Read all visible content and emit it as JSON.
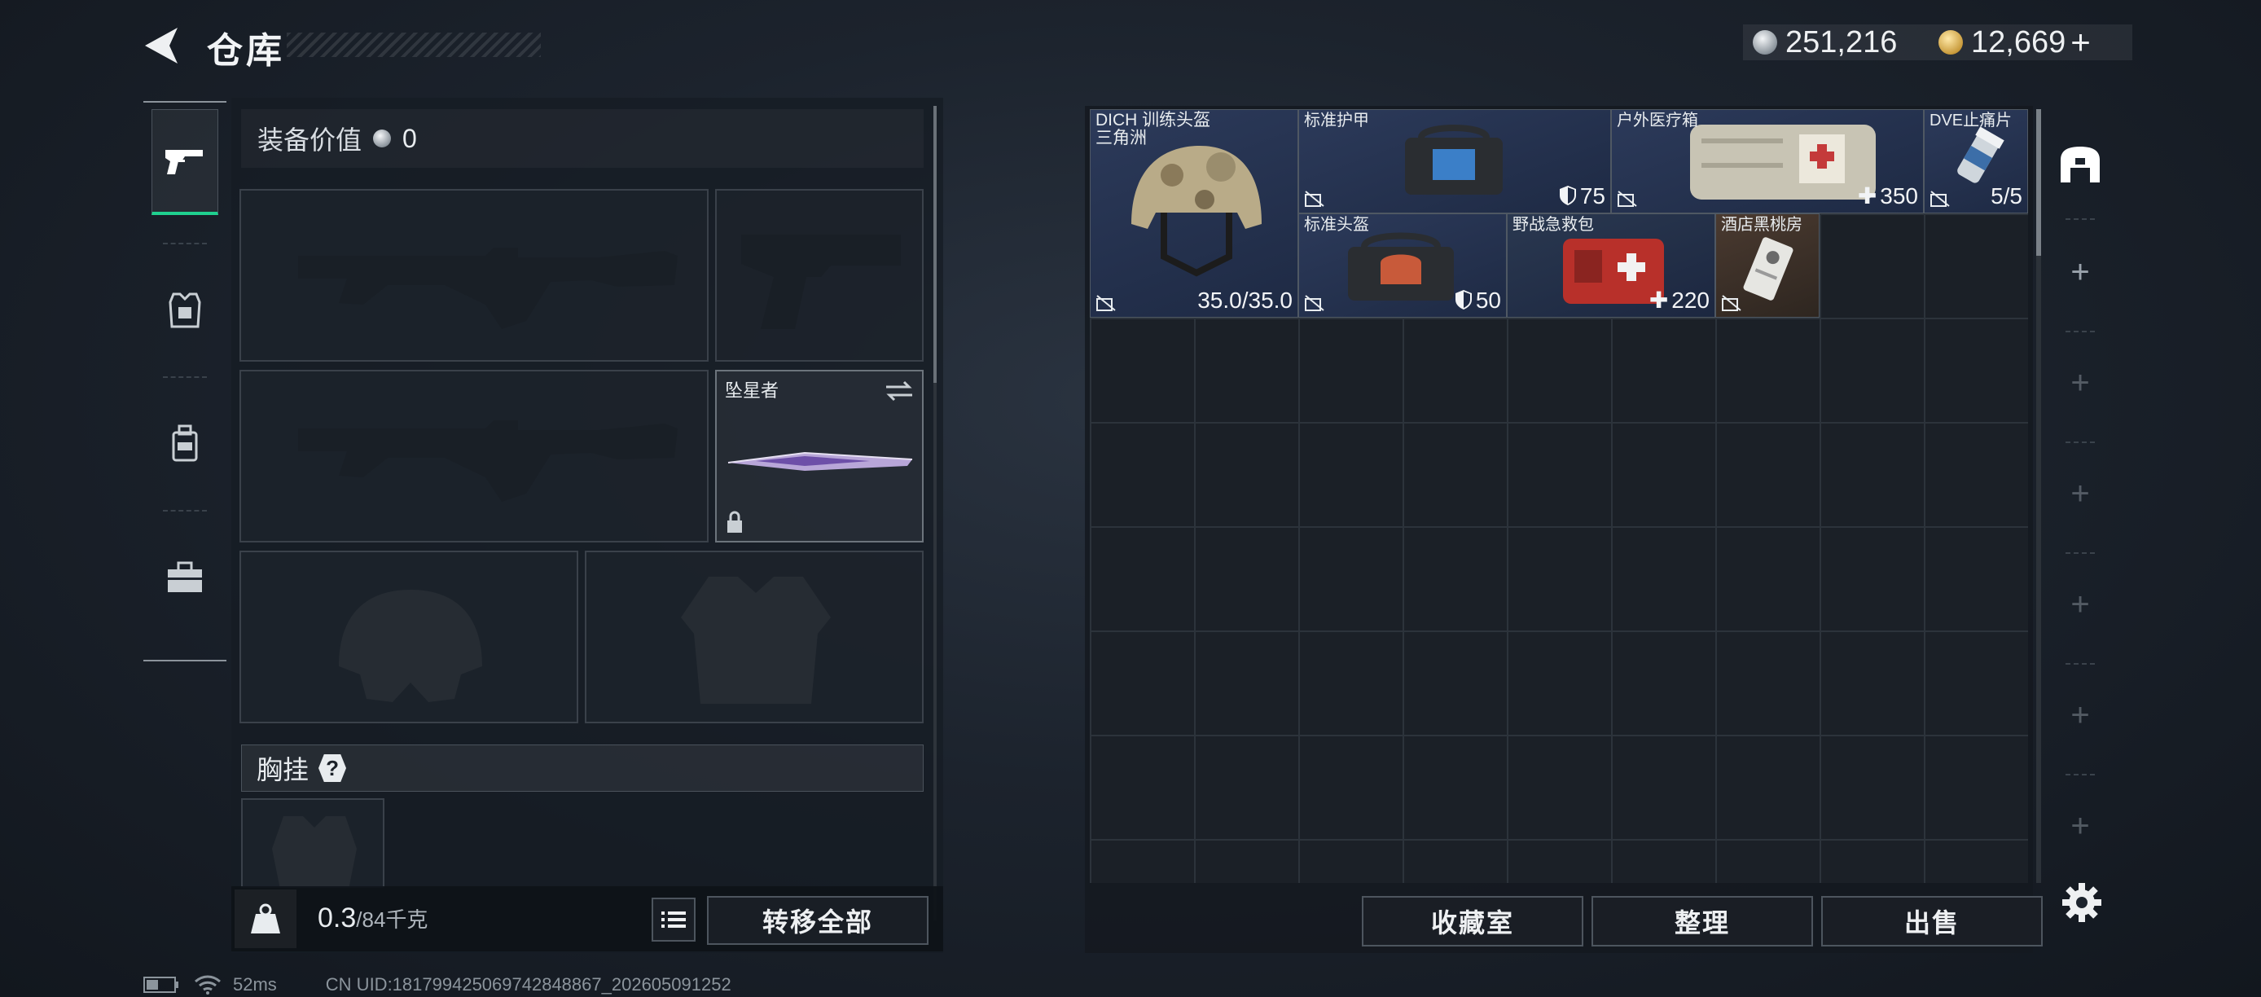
{
  "header": {
    "title": "仓库",
    "currency_primary": "251,216",
    "currency_secondary": "12,669",
    "add_label": "+"
  },
  "equipment": {
    "value_label": "装备价值",
    "value_amount": "0",
    "melee_name": "坠星者",
    "chest_rig_label": "胸挂",
    "help_label": "?"
  },
  "footer_left": {
    "weight_current": "0.3",
    "weight_max": "/84千克",
    "transfer_all_label": "转移全部"
  },
  "stash": {
    "items": [
      {
        "name": "DICH 训练头盔",
        "sub": "三角洲",
        "value": "35.0/35.0",
        "kind": "helmet-camo"
      },
      {
        "name": "标准护甲",
        "value": "75",
        "kind": "armor"
      },
      {
        "name": "户外医疗箱",
        "value": "350",
        "kind": "medkit-large"
      },
      {
        "name": "DVE止痛片",
        "value": "5/5",
        "kind": "pills"
      },
      {
        "name": "标准头盔",
        "value": "50",
        "kind": "helmet"
      },
      {
        "name": "野战急救包",
        "value": "220",
        "kind": "firstaid"
      },
      {
        "name": "酒店黑桃房",
        "value": "",
        "kind": "keycard"
      }
    ],
    "buttons": {
      "collection": "收藏室",
      "organize": "整理",
      "sell": "出售"
    }
  },
  "status_bar": {
    "ping": "52ms",
    "uid": "CN UID:1817994250697428488​67_202605091252"
  },
  "colors": {
    "accent": "#1fd08f",
    "background": "#1c232d"
  }
}
